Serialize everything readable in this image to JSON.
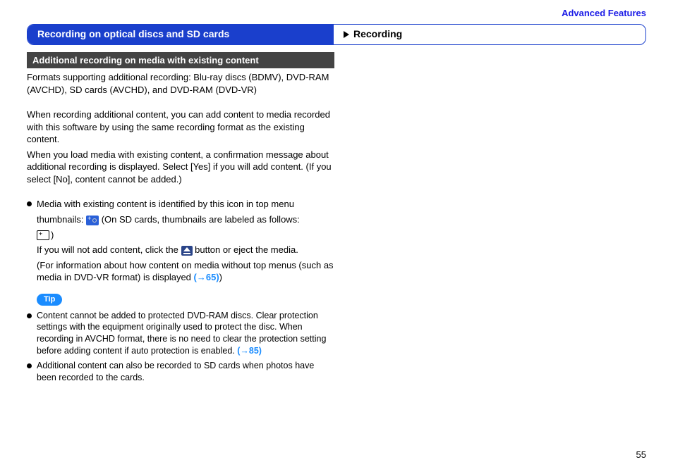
{
  "header": {
    "advanced_features": "Advanced Features"
  },
  "title_bar": {
    "left": "Recording on optical discs and SD cards",
    "right": "Recording"
  },
  "section": {
    "subhead": "Additional recording on media with existing content",
    "formats": "Formats supporting additional recording: Blu-ray discs (BDMV), DVD-RAM (AVCHD), SD cards (AVCHD), and DVD-RAM (DVD-VR)",
    "p1": "When recording additional content, you can add content to media recorded with this software by using the same recording format as the existing content.",
    "p2": "When you load media with existing content, a confirmation message about additional recording is displayed. Select [Yes] if you will add content. (If you select [No], content cannot be added.)",
    "bullet1_a": "Media with existing content is identified by this icon in top menu",
    "bullet1_b_before": "thumbnails: ",
    "bullet1_b_after": " (On SD cards, thumbnails are labeled as follows:",
    "bullet1_c_after": ")",
    "bullet1_d_before": "If you will not add content, click the ",
    "bullet1_d_after": " button or eject the media.",
    "bullet1_e_before": "(For information about how content on media without top menus (such as media in DVD-VR format) is displayed ",
    "bullet1_e_after": ")",
    "xref65": "(→65)",
    "tip_label": "Tip",
    "tip1": "Content cannot be added to protected DVD-RAM discs. Clear protection settings with the equipment originally used to protect the disc. When recording in AVCHD format, there is no need to clear the protection setting before adding content if auto protection is enabled. ",
    "xref85": "(→85)",
    "tip2": "Additional content can also be recorded to SD cards when photos have been recorded to the cards."
  },
  "page_number": "55"
}
